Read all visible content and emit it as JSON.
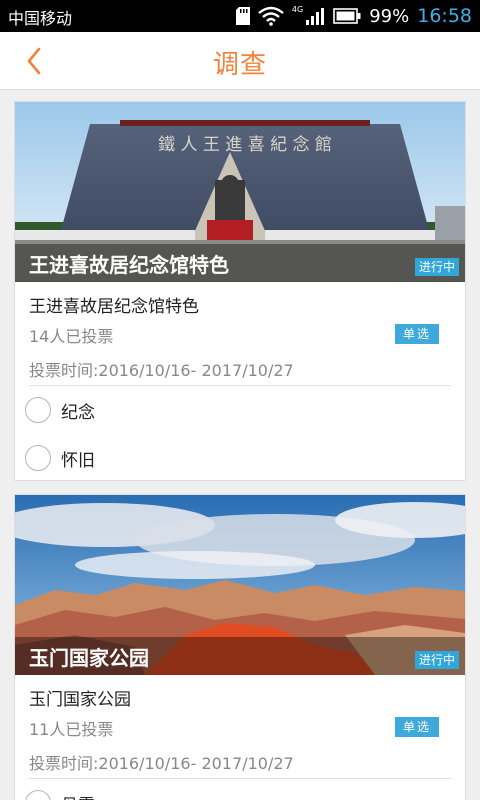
{
  "status_bar": {
    "carrier": "中国移动",
    "network": "4G",
    "battery": "99%",
    "time": "16:58",
    "time_color": "#3fb0e6"
  },
  "header": {
    "title": "调查",
    "back_icon": "chevron-left-icon",
    "accent": "#f3823a"
  },
  "surveys": [
    {
      "image_title": "王进喜故居纪念馆特色",
      "status": "进行中",
      "name": "王进喜故居纪念馆特色",
      "votes": "14人已投票",
      "type": "单选",
      "time": "投票时间:2016/10/16- 2017/10/27",
      "sign_text": "鐵 人 王 進 喜 紀 念 館",
      "options": [
        "纪念",
        "怀旧"
      ]
    },
    {
      "image_title": "玉门国家公园",
      "status": "进行中",
      "name": "玉门国家公园",
      "votes": "11人已投票",
      "type": "单选",
      "time": "投票时间:2016/10/16- 2017/10/27",
      "options": [
        "丹霞"
      ]
    }
  ]
}
